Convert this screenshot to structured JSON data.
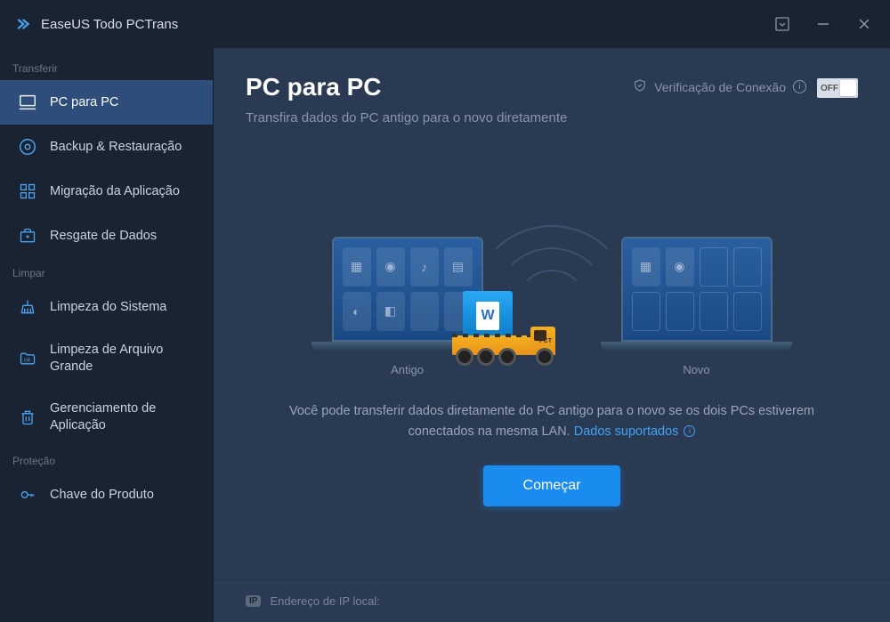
{
  "app": {
    "title": "EaseUS Todo PCTrans"
  },
  "sidebar": {
    "sections": [
      {
        "label": "Transferir"
      },
      {
        "label": "Limpar"
      },
      {
        "label": "Proteção"
      }
    ],
    "items": [
      {
        "label": "PC para PC"
      },
      {
        "label": "Backup & Restauração"
      },
      {
        "label": "Migração da Aplicação"
      },
      {
        "label": "Resgate de Dados"
      },
      {
        "label": "Limpeza do Sistema"
      },
      {
        "label": "Limpeza de Arquivo Grande"
      },
      {
        "label": "Gerenciamento de Aplicação"
      },
      {
        "label": "Chave do Produto"
      }
    ]
  },
  "main": {
    "title": "PC para PC",
    "subtitle": "Transfira dados do PC antigo para o novo diretamente",
    "verify_label": "Verificação de Conexão",
    "toggle_state": "OFF",
    "laptop_old_label": "Antigo",
    "laptop_new_label": "Novo",
    "truck_label": "PCT",
    "cargo_letter": "W",
    "desc_part1": "Você pode transferir dados diretamente do PC antigo para o novo se os dois PCs estiverem conectados na mesma LAN. ",
    "desc_link": "Dados suportados",
    "start_button": "Começar"
  },
  "footer": {
    "ip_badge": "IP",
    "ip_label": "Endereço de IP local:"
  }
}
